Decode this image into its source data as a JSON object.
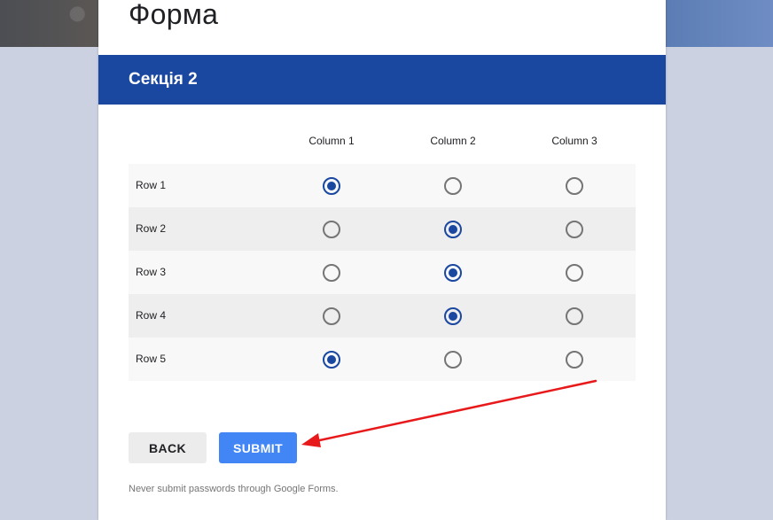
{
  "form": {
    "title": "Форма",
    "section_title": "Секція 2"
  },
  "grid": {
    "columns": [
      "Column 1",
      "Column 2",
      "Column 3"
    ],
    "rows": [
      {
        "label": "Row 1",
        "selected_column": 1
      },
      {
        "label": "Row 2",
        "selected_column": 2
      },
      {
        "label": "Row 3",
        "selected_column": 2
      },
      {
        "label": "Row 4",
        "selected_column": 2
      },
      {
        "label": "Row 5",
        "selected_column": 1
      }
    ]
  },
  "buttons": {
    "back_label": "BACK",
    "submit_label": "SUBMIT"
  },
  "footer": {
    "disclaimer": "Never submit passwords through Google Forms."
  },
  "colors": {
    "accent": "#1a47a0",
    "submit": "#4285f4",
    "annotation_arrow": "#e8191b"
  }
}
